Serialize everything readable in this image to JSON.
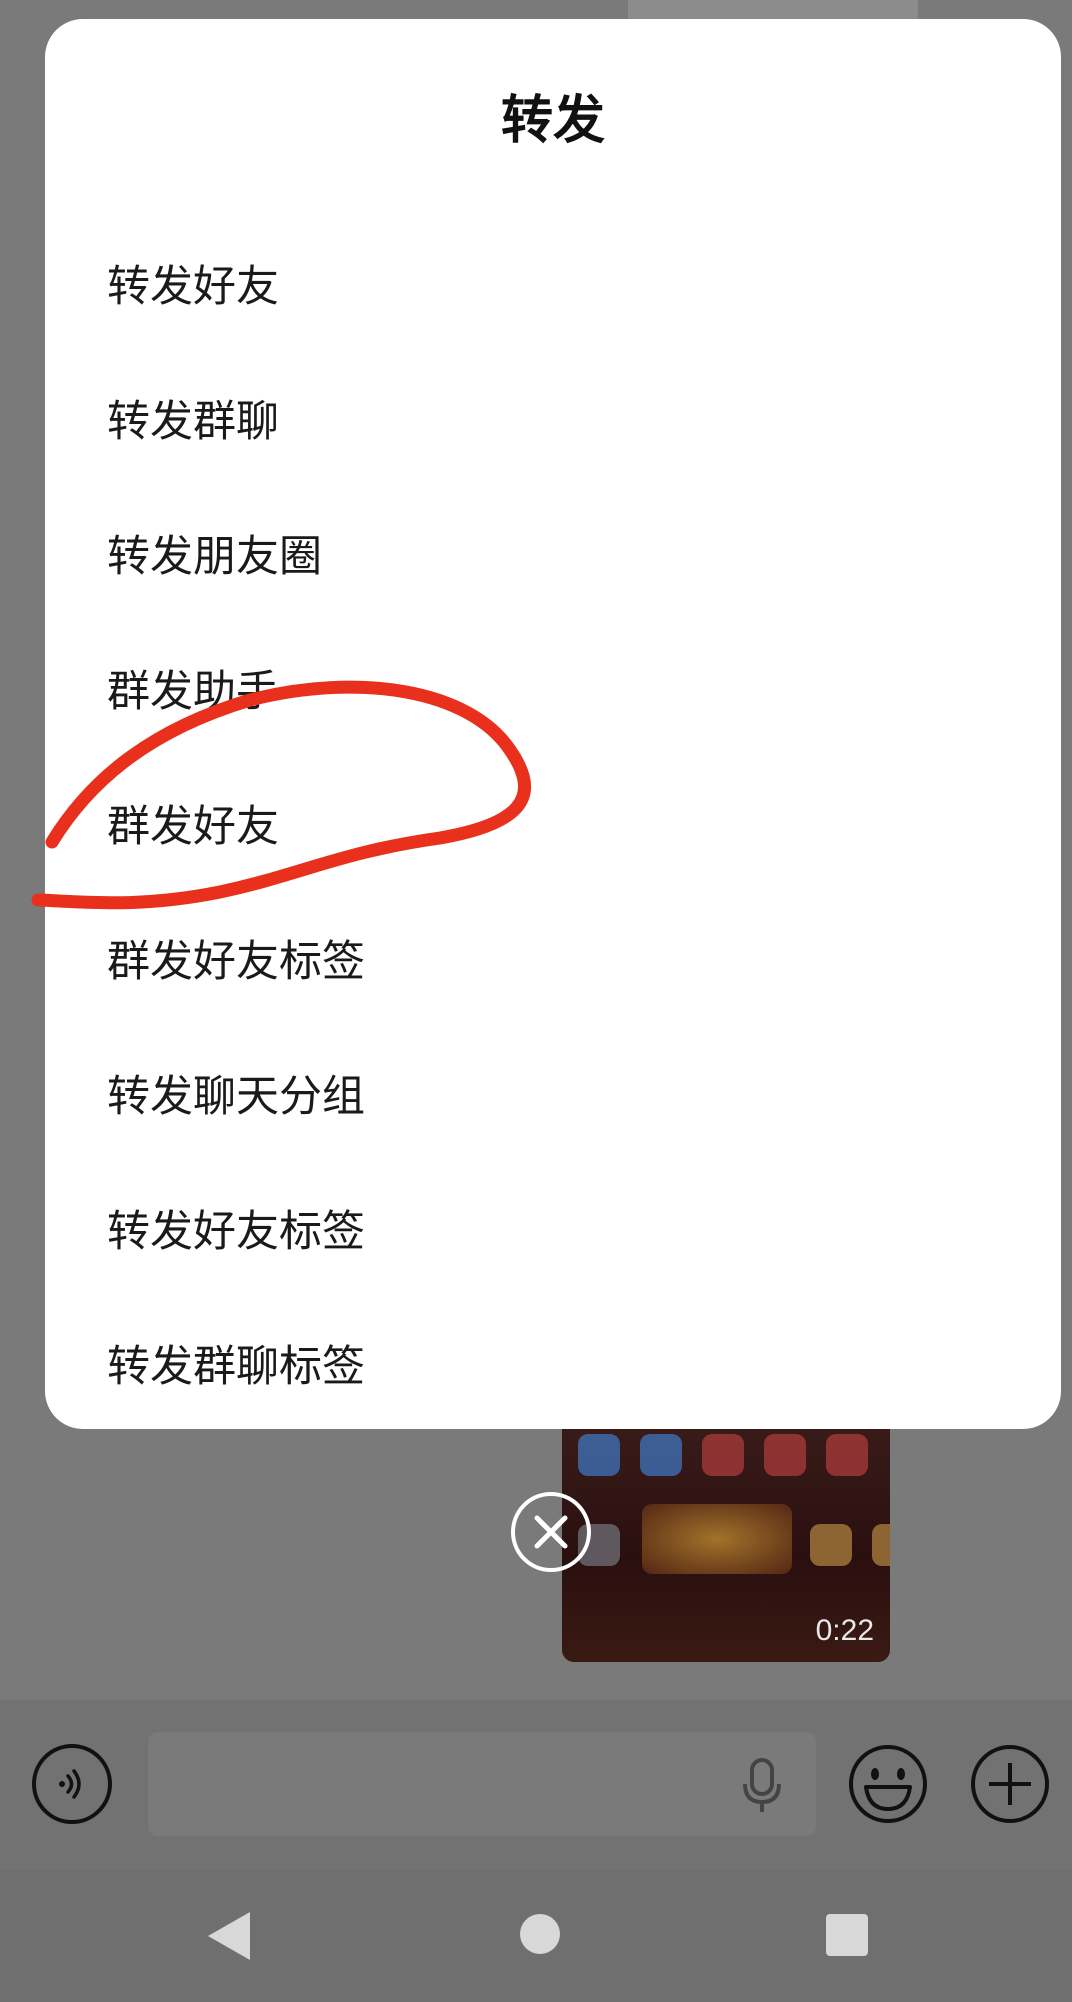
{
  "dialog": {
    "title": "转发",
    "items": [
      {
        "label": "转发好友"
      },
      {
        "label": "转发群聊"
      },
      {
        "label": "转发朋友圈"
      },
      {
        "label": "群发助手"
      },
      {
        "label": "群发好友"
      },
      {
        "label": "群发好友标签"
      },
      {
        "label": "转发聊天分组"
      },
      {
        "label": "转发好友标签"
      },
      {
        "label": "转发群聊标签"
      }
    ],
    "highlighted_item": "群发好友"
  },
  "video": {
    "duration": "0:22"
  },
  "colors": {
    "overlay": "#7d7d7d",
    "dialog_bg": "#ffffff",
    "annotation": "#e8301c",
    "text": "#1a1a1a"
  },
  "icons": {
    "close": "close-icon",
    "voice": "voice-icon",
    "mic": "microphone-icon",
    "emoji": "emoji-icon",
    "plus": "plus-icon",
    "nav_back": "back-triangle-icon",
    "nav_home": "home-circle-icon",
    "nav_recent": "recent-square-icon"
  }
}
